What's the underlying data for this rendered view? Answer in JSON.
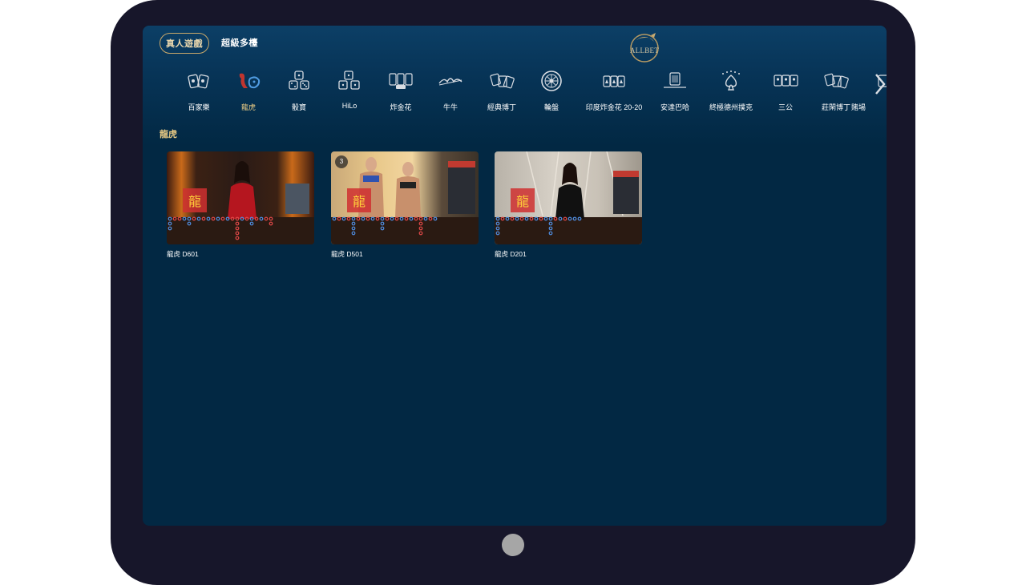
{
  "top_tabs": {
    "live": "真人遊戲",
    "multi": "超級多檯"
  },
  "brand": {
    "logo_text": "ALLBET"
  },
  "categories": [
    {
      "label": "百家樂",
      "icon": "baccarat-cards-icon",
      "active": false
    },
    {
      "label": "龍虎",
      "icon": "dragon-tiger-icon",
      "active": true
    },
    {
      "label": "骰寶",
      "icon": "dice-icon",
      "active": false
    },
    {
      "label": "HiLo",
      "icon": "hilo-dice-icon",
      "active": false
    },
    {
      "label": "炸金花",
      "icon": "three-cards-icon",
      "active": false
    },
    {
      "label": "牛牛",
      "icon": "bull-icon",
      "active": false
    },
    {
      "label": "經典博丁",
      "icon": "pontoon-cards-icon",
      "active": false
    },
    {
      "label": "輪盤",
      "icon": "roulette-icon",
      "active": false
    },
    {
      "label": "印度炸金花 20-20",
      "icon": "teen-patti-icon",
      "active": false
    },
    {
      "label": "安達巴哈",
      "icon": "andar-bahar-icon",
      "active": false
    },
    {
      "label": "終極德州撲克",
      "icon": "spade-icon",
      "active": false
    },
    {
      "label": "三公",
      "icon": "three-face-cards-icon",
      "active": false
    },
    {
      "label": "莊閑博丁",
      "icon": "banker-player-cards-icon",
      "active": false
    },
    {
      "label": "賭場",
      "icon": "casino-icon",
      "active": false
    }
  ],
  "section": {
    "title": "龍虎"
  },
  "tables": [
    {
      "name": "龍虎 D601",
      "badge": ""
    },
    {
      "name": "龍虎 D501",
      "badge": "3"
    },
    {
      "name": "龍虎 D201",
      "badge": ""
    }
  ],
  "colors": {
    "screen_bg": "#022843",
    "accent_gold": "#e7c984",
    "bezel": "#17162a"
  }
}
